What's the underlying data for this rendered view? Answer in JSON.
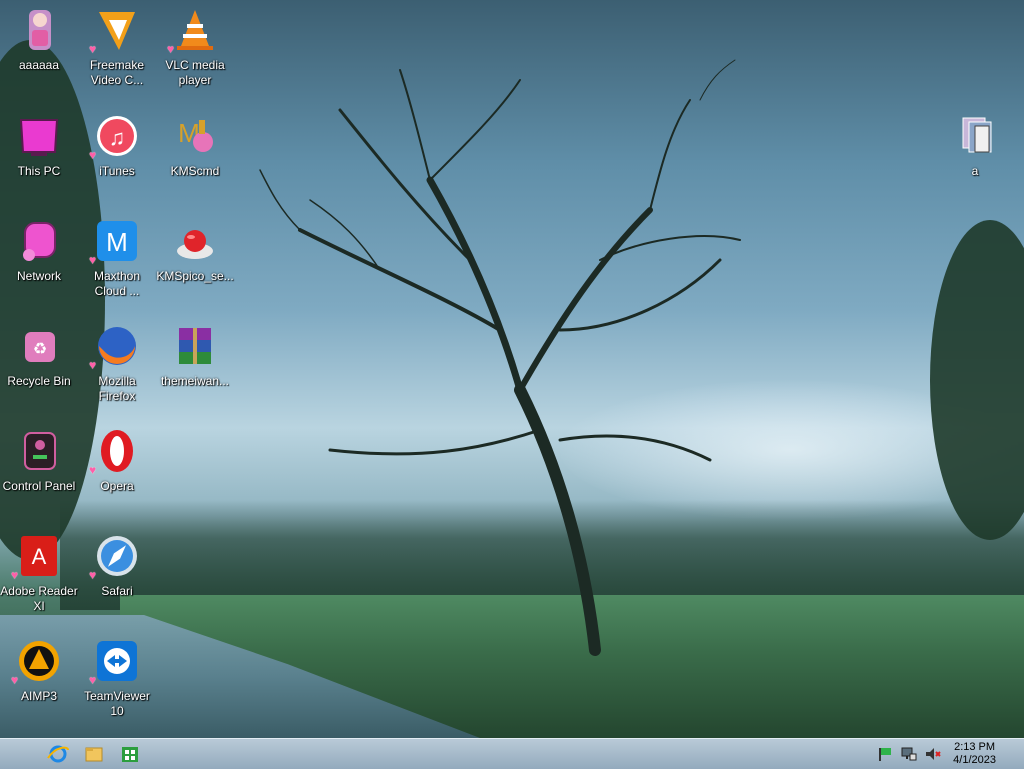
{
  "desktop_icons": [
    {
      "label": "aaaaaa",
      "icon": "doll-icon"
    },
    {
      "label": "Freemake\nVideo C...",
      "icon": "freemake-icon"
    },
    {
      "label": "VLC media\nplayer",
      "icon": "vlc-cone-icon"
    },
    {
      "label": "This PC",
      "icon": "computer-icon"
    },
    {
      "label": "iTunes",
      "icon": "itunes-icon"
    },
    {
      "label": "KMScmd",
      "icon": "kmscmd-icon"
    },
    {
      "label": "Network",
      "icon": "network-icon"
    },
    {
      "label": "Maxthon\nCloud ...",
      "icon": "maxthon-icon"
    },
    {
      "label": "KMSpico_se...",
      "icon": "kmspico-icon"
    },
    {
      "label": "Recycle Bin",
      "icon": "recycle-bin-icon"
    },
    {
      "label": "Mozilla\nFirefox",
      "icon": "firefox-icon"
    },
    {
      "label": "themeiwan...",
      "icon": "winrar-icon"
    },
    {
      "label": "Control Panel",
      "icon": "control-panel-icon"
    },
    {
      "label": "Opera",
      "icon": "opera-icon"
    },
    {
      "label": "Adobe Reader\nXI",
      "icon": "adobe-reader-icon"
    },
    {
      "label": "Safari",
      "icon": "safari-icon"
    },
    {
      "label": "AIMP3",
      "icon": "aimp-icon"
    },
    {
      "label": "TeamViewer\n10",
      "icon": "teamviewer-icon"
    },
    {
      "label": "a",
      "icon": "folder-images-icon"
    }
  ],
  "taskbar": {
    "pinned": [
      "internet-explorer-icon",
      "file-explorer-icon",
      "store-icon"
    ],
    "tray": [
      "flag-icon",
      "network-tray-icon",
      "volume-muted-icon"
    ],
    "clock": {
      "time": "2:13 PM",
      "date": "4/1/2023"
    }
  },
  "colors": {
    "taskbar": "#a7bccc",
    "label_text": "#ffffff",
    "heart": "#ff5fa8"
  }
}
